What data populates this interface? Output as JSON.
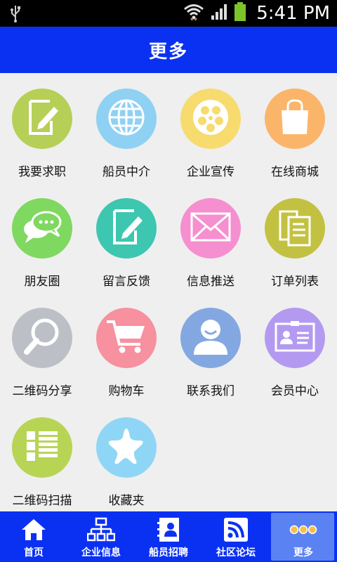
{
  "status": {
    "time": "5:41 PM"
  },
  "header": {
    "title": "更多"
  },
  "grid": {
    "items": [
      {
        "label": "我要求职",
        "color": "#b6cf57"
      },
      {
        "label": "船员中介",
        "color": "#8fd1f3"
      },
      {
        "label": "企业宣传",
        "color": "#f7db6e"
      },
      {
        "label": "在线商城",
        "color": "#fbb56a"
      },
      {
        "label": "朋友圈",
        "color": "#7fd85f"
      },
      {
        "label": "留言反馈",
        "color": "#3dc6b0"
      },
      {
        "label": "信息推送",
        "color": "#f68fcf"
      },
      {
        "label": "订单列表",
        "color": "#c3c142"
      },
      {
        "label": "二维码分享",
        "color": "#bcc0c6"
      },
      {
        "label": "购物车",
        "color": "#f7909f"
      },
      {
        "label": "联系我们",
        "color": "#83a8e1"
      },
      {
        "label": "会员中心",
        "color": "#b39af0"
      },
      {
        "label": "二维码扫描",
        "color": "#b8d455"
      },
      {
        "label": "收藏夹",
        "color": "#8fd6f6"
      }
    ]
  },
  "tabbar": {
    "tabs": [
      {
        "label": "首页"
      },
      {
        "label": "企业信息"
      },
      {
        "label": "船员招聘"
      },
      {
        "label": "社区论坛"
      },
      {
        "label": "更多"
      }
    ]
  }
}
